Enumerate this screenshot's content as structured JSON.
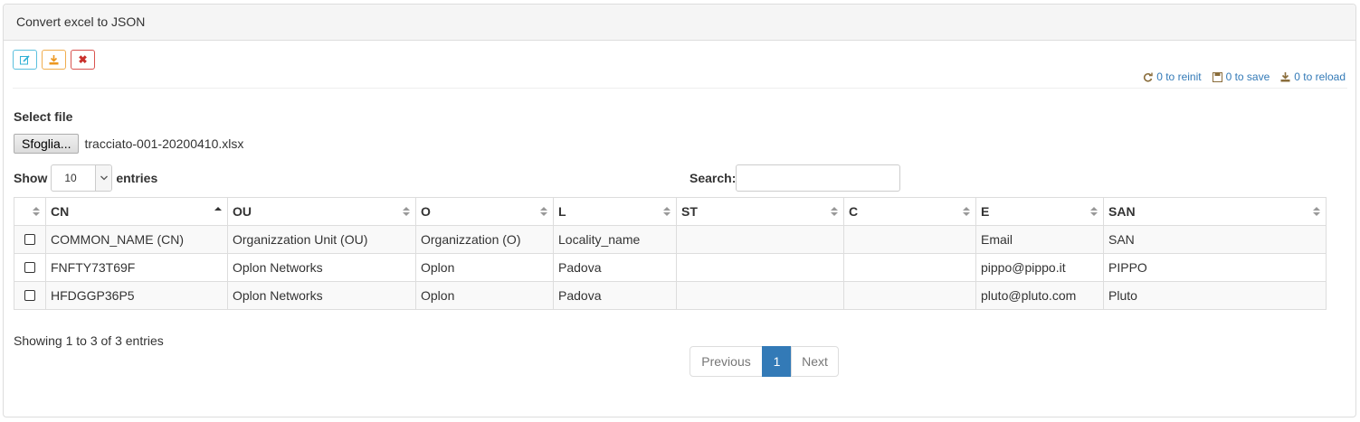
{
  "panel": {
    "title": "Convert excel to JSON"
  },
  "toolbar": {
    "edit_icon": "edit-icon",
    "download_icon": "download-icon",
    "delete_icon": "close-icon",
    "colors": {
      "info": "#5bc0de",
      "warning": "#f0ad4e",
      "danger": "#d9534f"
    }
  },
  "status": {
    "reinit": "0 to reinit",
    "save": "0 to save",
    "reload": "0 to reload"
  },
  "file": {
    "label": "Select file",
    "button": "Sfoglia...",
    "name": "tracciato-001-20200410.xlsx"
  },
  "length": {
    "show": "Show",
    "value": "10",
    "entries": "entries"
  },
  "search": {
    "label": "Search:",
    "value": ""
  },
  "table": {
    "columns": [
      "CN",
      "OU",
      "O",
      "L",
      "ST",
      "C",
      "E",
      "SAN"
    ],
    "rows": [
      [
        "COMMON_NAME (CN)",
        "Organizzation Unit (OU)",
        "Organizzation (O)",
        "Locality_name",
        "",
        "",
        "Email",
        "SAN"
      ],
      [
        "FNFTY73T69F",
        "Oplon Networks",
        "Oplon",
        "Padova",
        "",
        "",
        "pippo@pippo.it",
        "PIPPO"
      ],
      [
        "HFDGGP36P5",
        "Oplon Networks",
        "Oplon",
        "Padova",
        "",
        "",
        "pluto@pluto.com",
        "Pluto"
      ]
    ]
  },
  "info": "Showing 1 to 3 of 3 entries",
  "pagination": {
    "previous": "Previous",
    "current": "1",
    "next": "Next",
    "accent": "#337ab7"
  }
}
